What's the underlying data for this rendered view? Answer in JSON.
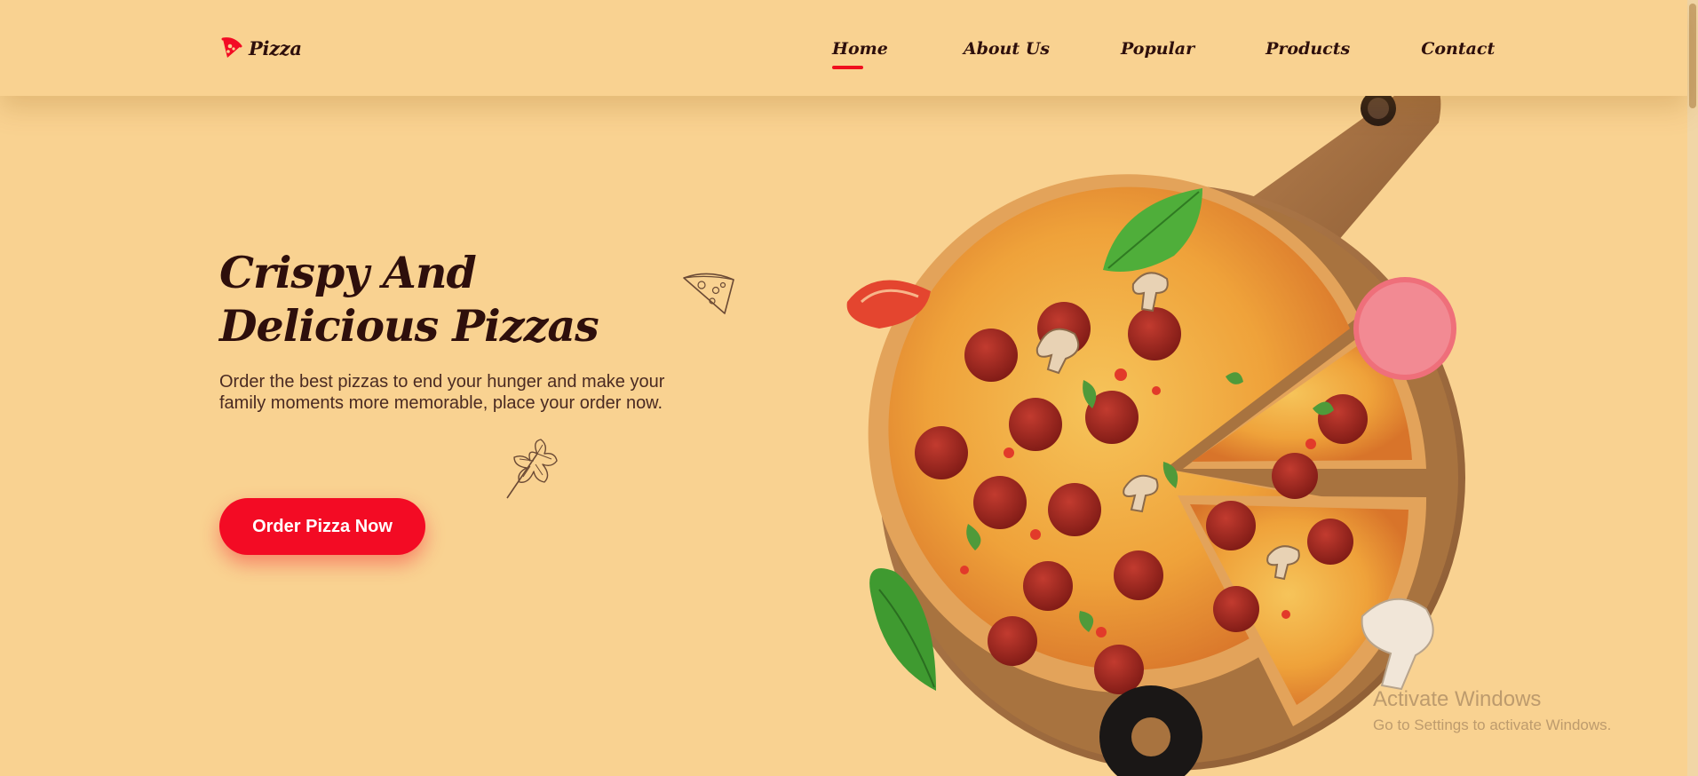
{
  "brand": {
    "name": "Pizza"
  },
  "nav": {
    "items": [
      {
        "label": "Home",
        "active": true
      },
      {
        "label": "About Us",
        "active": false
      },
      {
        "label": "Popular",
        "active": false
      },
      {
        "label": "Products",
        "active": false
      },
      {
        "label": "Contact",
        "active": false
      }
    ]
  },
  "hero": {
    "title_line1": "Crispy And",
    "title_line2": "Delicious Pizzas",
    "description": "Order the best pizzas to end your hunger and make your family moments more memorable, place your order now.",
    "cta_label": "Order Pizza Now"
  },
  "watermark": {
    "title": "Activate Windows",
    "subtitle": "Go to Settings to activate Windows."
  },
  "colors": {
    "background": "#f9d291",
    "accent": "#f30b24",
    "text_dark": "#2e0f0c"
  }
}
